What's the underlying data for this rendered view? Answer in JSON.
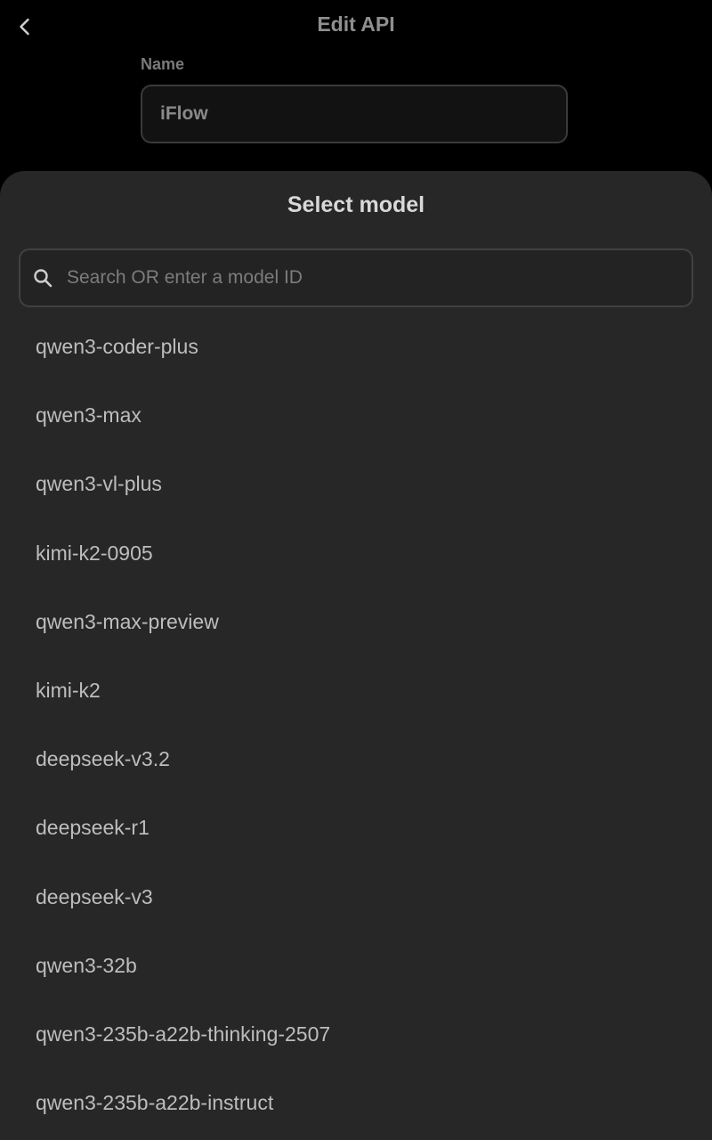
{
  "header": {
    "title": "Edit API",
    "back_icon": "chevron-left-icon"
  },
  "form": {
    "name_label": "Name",
    "name_value": "iFlow"
  },
  "sheet": {
    "title": "Select model",
    "search": {
      "icon": "search-icon",
      "placeholder": "Search OR enter a model ID",
      "value": ""
    },
    "models": [
      "qwen3-coder-plus",
      "qwen3-max",
      "qwen3-vl-plus",
      "kimi-k2-0905",
      "qwen3-max-preview",
      "kimi-k2",
      "deepseek-v3.2",
      "deepseek-r1",
      "deepseek-v3",
      "qwen3-32b",
      "qwen3-235b-a22b-thinking-2507",
      "qwen3-235b-a22b-instruct"
    ]
  },
  "colors": {
    "background": "#000000",
    "sheet": "#272727",
    "text_primary": "#d8d8d8",
    "text_secondary": "#bdbdbd"
  }
}
